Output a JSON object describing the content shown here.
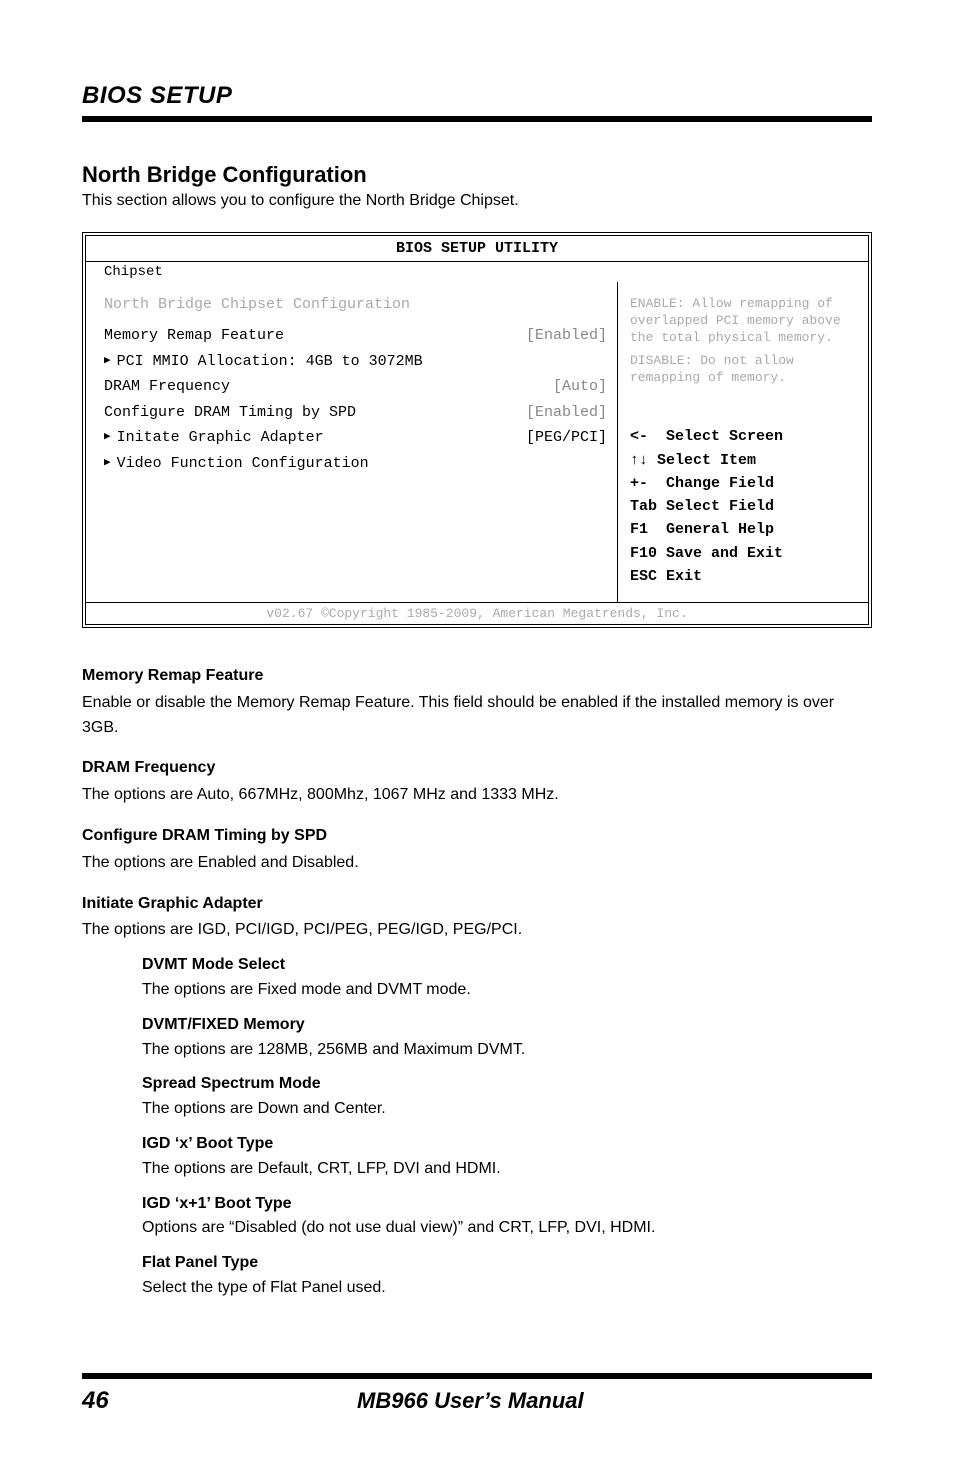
{
  "header": {
    "title": "BIOS SETUP"
  },
  "section": {
    "title": "North Bridge Configuration",
    "subtitle": "This section allows you to configure the North Bridge Chipset."
  },
  "bios": {
    "title": "BIOS SETUP UTILITY",
    "tabs": [
      "Chipset"
    ],
    "active_tab": 0,
    "left": {
      "heading": "North Bridge Chipset Configuration",
      "rows": [
        {
          "type": "kv",
          "label": "Memory Remap Feature",
          "value": "[Enabled]",
          "muted": true
        },
        {
          "type": "sub",
          "label": "PCI MMIO Allocation: 4GB to 3072MB"
        },
        {
          "type": "kv",
          "label": "DRAM Frequency",
          "value": "[Auto]",
          "muted": true
        },
        {
          "type": "kv",
          "label": "Configure DRAM Timing by SPD",
          "value": "[Enabled]",
          "muted": true
        },
        {
          "type": "kv",
          "label": "Initate Graphic Adapter",
          "value": "[PEG/PCI]",
          "muted": false
        },
        {
          "type": "sub",
          "label": "Video Function Configuration"
        }
      ]
    },
    "right": {
      "hint_top": "ENABLE: Allow remapping of overlapped PCI memory above the total physical memory.",
      "hint_bottom": "DISABLE: Do not allow remapping of memory.",
      "help": {
        "l1": "<-  Select Screen",
        "l2": "↑↓ Select Item",
        "l3": "+-  Change Field",
        "l4": "Tab Select Field",
        "l5": "F1  General Help",
        "l6": "F10 Save and Exit",
        "l7": "ESC Exit"
      }
    },
    "footer": "v02.67 ©Copyright 1985-2009, American Megatrends, Inc."
  },
  "definitions": {
    "term1": {
      "title": "Memory Remap Feature",
      "body": "Enable or disable the Memory Remap Feature. This field should be enabled if the installed memory is over 3GB."
    },
    "term2": {
      "title": "DRAM Frequency",
      "body": "The options are Auto, 667MHz, 800Mhz, 1067 MHz and 1333 MHz."
    },
    "term3": {
      "title": "Configure DRAM Timing by SPD",
      "body": "The options are Enabled and Disabled."
    },
    "term4": {
      "title": "Initiate Graphic Adapter",
      "body": "The options are IGD, PCI/IGD, PCI/PEG, PEG/IGD, PEG/PCI."
    },
    "nested": {
      "s1": {
        "title": "DVMT Mode Select",
        "body": "The options are Fixed mode and DVMT mode."
      },
      "s2": {
        "title": "DVMT/FIXED Memory",
        "body": "The options are 128MB, 256MB and Maximum DVMT."
      },
      "s3": {
        "title": "Spread Spectrum Mode",
        "body": "The options are Down and Center."
      },
      "s4": {
        "title": "IGD ‘x’ Boot Type",
        "body": "The options are Default, CRT, LFP, DVI and HDMI."
      },
      "s5": {
        "title": "IGD ‘x+1’ Boot Type",
        "body": "Options are “Disabled (do not use dual view)” and CRT, LFP, DVI, HDMI."
      },
      "s6": {
        "title": "Flat Panel Type",
        "body": "Select the type of Flat Panel used."
      }
    }
  },
  "footer": {
    "page": "46",
    "center": "MB966 User’s Manual"
  }
}
